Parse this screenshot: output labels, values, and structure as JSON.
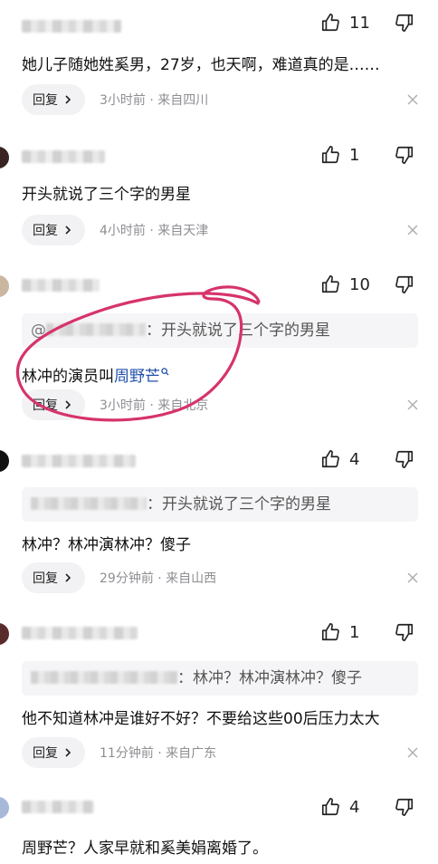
{
  "comments": [
    {
      "like_count": "11",
      "text": "她儿子随她姓奚男，27岁，也天啊，难道真的是……",
      "reply_label": "回复",
      "meta": "3小时前 · 来自四川"
    },
    {
      "like_count": "1",
      "text": "开头就说了三个字的男星",
      "reply_label": "回复",
      "meta": "4小时前 · 来自天津"
    },
    {
      "like_count": "10",
      "quote_prefix": "@",
      "quote_text": "：开头就说了三个字的男星",
      "text_prefix": "林冲的演员叫",
      "text_link": "周野芒",
      "reply_label": "回复",
      "meta": "3小时前 · 来自北京"
    },
    {
      "like_count": "4",
      "quote_text": "：开头就说了三个字的男星",
      "text": "林冲？林冲演林冲？傻子",
      "reply_label": "回复",
      "meta": "29分钟前 · 来自山西"
    },
    {
      "like_count": "1",
      "quote_text": "：林冲？林冲演林冲？傻子",
      "text": "他不知道林冲是谁好不好？不要给这些00后压力太大",
      "reply_label": "回复",
      "meta": "11分钟前 · 来自广东"
    },
    {
      "like_count": "4",
      "text": "周野芒？人家早就和奚美娟离婚了。"
    }
  ],
  "icons": {
    "like": "thumbs-up-icon",
    "dislike": "thumbs-down-icon",
    "reply_arrow": "chevron-right-icon",
    "close": "close-icon",
    "search": "search-icon"
  },
  "colors": {
    "link": "#1f4fa8",
    "meta_gray": "#8e8e93",
    "annotation_circle": "#d6336c",
    "quote_bg": "#f5f5f7"
  }
}
